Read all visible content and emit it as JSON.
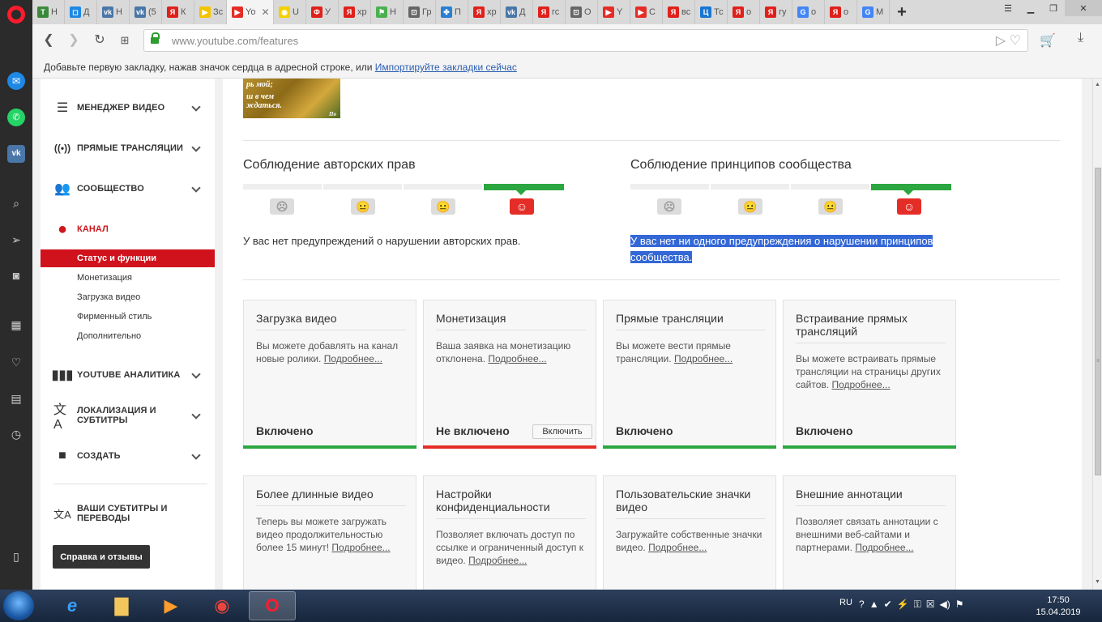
{
  "browser": {
    "tabs": [
      {
        "label": "Н",
        "fav": "Т",
        "color": "#3b8a3b"
      },
      {
        "label": "Д",
        "fav": "◻",
        "color": "#1e88e5"
      },
      {
        "label": "Н",
        "fav": "vk",
        "color": "#4a76a8"
      },
      {
        "label": "(5",
        "fav": "vk",
        "color": "#4a76a8"
      },
      {
        "label": "К",
        "fav": "Я",
        "color": "#e0201b"
      },
      {
        "label": "Зс",
        "fav": "▶",
        "color": "#f5c400"
      },
      {
        "label": "Yo",
        "fav": "▶",
        "color": "#e52d27",
        "active": true
      },
      {
        "label": "U",
        "fav": "◉",
        "color": "#f5d000"
      },
      {
        "label": "У",
        "fav": "Ф",
        "color": "#e0201b"
      },
      {
        "label": "хр",
        "fav": "Я",
        "color": "#e0201b"
      },
      {
        "label": "Н",
        "fav": "⚑",
        "color": "#4caf50"
      },
      {
        "label": "Гр",
        "fav": "⊡",
        "color": "#666"
      },
      {
        "label": "П",
        "fav": "✤",
        "color": "#2a7fd4"
      },
      {
        "label": "хр",
        "fav": "Я",
        "color": "#e0201b"
      },
      {
        "label": "Д",
        "fav": "vk",
        "color": "#4a76a8"
      },
      {
        "label": "гс",
        "fav": "Я",
        "color": "#e0201b"
      },
      {
        "label": "О",
        "fav": "⊡",
        "color": "#666"
      },
      {
        "label": "Y",
        "fav": "▶",
        "color": "#e52d27"
      },
      {
        "label": "С",
        "fav": "▶",
        "color": "#e52d27"
      },
      {
        "label": "вс",
        "fav": "Я",
        "color": "#e0201b"
      },
      {
        "label": "Тс",
        "fav": "Ц",
        "color": "#1976d2"
      },
      {
        "label": "о",
        "fav": "Я",
        "color": "#e0201b"
      },
      {
        "label": "гу",
        "fav": "Я",
        "color": "#e0201b"
      },
      {
        "label": "о",
        "fav": "G",
        "color": "#4285f4"
      },
      {
        "label": "о",
        "fav": "Я",
        "color": "#e0201b"
      },
      {
        "label": "М",
        "fav": "G",
        "color": "#4285f4"
      }
    ],
    "new_tab": "+",
    "url_host": "www.youtube.com",
    "url_path": "/features",
    "bookmark_hint": "Добавьте первую закладку, нажав значок сердца в адресной строке, или",
    "bookmark_link": "Импортируйте закладки сейчас"
  },
  "sidebar": {
    "items": [
      {
        "label": "МЕНЕДЖЕР ВИДЕО",
        "icon": "video-manager-icon"
      },
      {
        "label": "ПРЯМЫЕ ТРАНСЛЯЦИИ",
        "icon": "live-icon"
      },
      {
        "label": "СООБЩЕСТВО",
        "icon": "community-icon"
      },
      {
        "label": "КАНАЛ",
        "icon": "channel-icon"
      },
      {
        "label": "YOUTUBE АНАЛИТИКА",
        "icon": "analytics-icon"
      },
      {
        "label": "ЛОКАЛИЗАЦИЯ И СУБТИТРЫ",
        "icon": "translate-icon"
      },
      {
        "label": "СОЗДАТЬ",
        "icon": "create-icon"
      },
      {
        "label": "ВАШИ СУБТИТРЫ И ПЕРЕВОДЫ",
        "icon": "subtitles-icon"
      }
    ],
    "channel_sub": [
      "Статус и функции",
      "Монетизация",
      "Загрузка видео",
      "Фирменный стиль",
      "Дополнительно"
    ],
    "help_button": "Справка и отзывы"
  },
  "main": {
    "thumb_text": [
      "рь мой;",
      "ш в чем",
      "ждаться.",
      "По"
    ],
    "copyright": {
      "title": "Соблюдение авторских прав",
      "status": "У вас нет предупреждений о нарушении авторских прав."
    },
    "community": {
      "title": "Соблюдение принципов сообщества",
      "status_line1": "У вас нет ни одного предупреждения о нарушении принципов",
      "status_line2": "сообщества."
    },
    "cards": [
      {
        "title": "Загрузка видео",
        "desc": "Вы можете добавлять на канал новые ролики.",
        "more": "Подробнее...",
        "status": "Включено",
        "state": "on"
      },
      {
        "title": "Монетизация",
        "desc": "Ваша заявка на монетизацию отклонена.",
        "more": "Подробнее...",
        "status": "Не включено",
        "state": "off",
        "button": "Включить"
      },
      {
        "title": "Прямые трансляции",
        "desc": "Вы можете вести прямые трансляции.",
        "more": "Подробнее...",
        "status": "Включено",
        "state": "on"
      },
      {
        "title": "Встраивание прямых трансляций",
        "desc": "Вы можете встраивать прямые трансляции на страницы других сайтов.",
        "more": "Подробнее...",
        "status": "Включено",
        "state": "on"
      },
      {
        "title": "Более длинные видео",
        "desc": "Теперь вы можете загружать видео продолжительностью более 15 минут!",
        "more": "Подробнее..."
      },
      {
        "title": "Настройки конфиденциальности",
        "desc": "Позволяет включать доступ по ссылке и ограниченный доступ к видео.",
        "more": "Подробнее..."
      },
      {
        "title": "Пользовательские значки видео",
        "desc": "Загружайте собственные значки видео.",
        "more": "Подробнее..."
      },
      {
        "title": "Внешние аннотации",
        "desc": "Позволяет связать аннотации с внешними веб-сайтами и партнерами.",
        "more": "Подробнее..."
      }
    ]
  },
  "taskbar": {
    "lang": "RU",
    "time": "17:50",
    "date": "15.04.2019"
  },
  "colors": {
    "accent_red": "#cc181e",
    "good_green": "#2ba640",
    "bad_red": "#e52d27"
  }
}
